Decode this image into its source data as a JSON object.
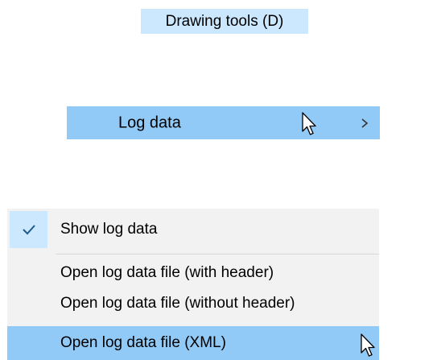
{
  "menubar": {
    "drawing_tools_label": "Drawing tools (D)"
  },
  "submenu": {
    "log_data_label": "Log data",
    "chevron_icon": "chevron-right-icon"
  },
  "menu": {
    "items": [
      {
        "label": "Show log data",
        "checked": true,
        "icon": "checkmark-icon"
      },
      {
        "label": "Open log data file (with header)"
      },
      {
        "label": "Open log data file (without header)"
      },
      {
        "label": "Open log data file (XML)",
        "highlighted": true
      }
    ]
  },
  "colors": {
    "menubar_highlight": "#cce8ff",
    "item_hover": "#91c9f7",
    "menu_background": "#f2f2f2",
    "checkmark": "#1f5a8c"
  },
  "cursor_icon": "arrow-cursor-icon"
}
